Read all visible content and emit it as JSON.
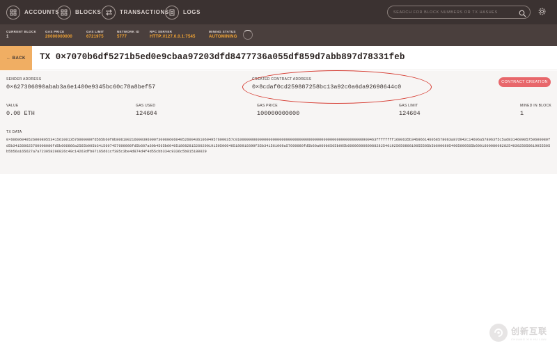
{
  "nav": {
    "items": [
      {
        "label": "ACCOUNTS",
        "icon": "accounts-grid-icon"
      },
      {
        "label": "BLOCKS",
        "icon": "blocks-grid-icon"
      },
      {
        "label": "TRANSACTIONS",
        "icon": "transactions-arrows-icon"
      },
      {
        "label": "LOGS",
        "icon": "logs-document-icon"
      }
    ],
    "search_placeholder": "SEARCH FOR BLOCK NUMBERS OR TX HASHES"
  },
  "status": {
    "current_block": {
      "label": "CURRENT BLOCK",
      "value": "1"
    },
    "gas_price": {
      "label": "GAS PRICE",
      "value": "20000000000"
    },
    "gas_limit": {
      "label": "GAS LIMIT",
      "value": "6721975"
    },
    "network_id": {
      "label": "NETWORK ID",
      "value": "5777"
    },
    "rpc_server": {
      "label": "RPC SERVER",
      "value": "HTTP://127.0.0.1:7545"
    },
    "mining_status": {
      "label": "MINING STATUS",
      "value": "AUTOMINING"
    }
  },
  "tx": {
    "back_label": "← BACK",
    "title": "TX 0×7070b6df5271b5ed0e9cbaa97203dfd8477736a055df859d7abb897d78331feb",
    "sender_label": "SENDER ADDRESS",
    "sender": "0×627306090abab3a6e1400e9345bc60c78a8bef57",
    "contract_label": "CREATED CONTRACT ADDRESS",
    "contract": "0×8cdaf0cd259887258bc13a92c0a6da92698644c0",
    "badge": "CONTRACT CREATION",
    "value_label": "VALUE",
    "value": "0.00 ETH",
    "gas_used_label": "GAS USED",
    "gas_used": "124604",
    "gas_price_label": "GAS PRICE",
    "gas_price": "100000000000",
    "gas_limit_label": "GAS LIMIT",
    "gas_limit": "124604",
    "mined_label": "MINED IN BLOCK",
    "mined": "1",
    "data_label": "TX DATA",
    "data": "0×6060604052600080553415610013576000080fd5b5b60f8b806100216000396000f3006060604052600436106049576000357c0100000000000000000000000000000000000000000000000000000000900463ffffffff1680635b34b966146058578063a87d942c14606a578063f5c5ad831460905750600080fd5b341560625760008080fd5b606866a2565b005b3415607457600080fd5b607a60b4565b6040518082815260200191505060405180910390f35b341561009a57600080fd5b60a060b6565b005b6000600080088282540192505080819055505b5b60008054905090565b6001600080082825403925050819055505b5b56a165627a7a723058206826c49c14263dfb07165d61cf385c3be4d874d4f4d55cbb334c9336c5b015180029"
  },
  "watermark": {
    "cn": "创新互联",
    "en": "CHUANG XIN HU LIAN"
  },
  "colors": {
    "nav_bg": "#3b3231",
    "status_bg": "#4a3f3d",
    "accent_orange": "#f4a533",
    "back_button": "#f0ae63",
    "badge_red": "#e8676b",
    "ring_red": "#d63a30"
  }
}
